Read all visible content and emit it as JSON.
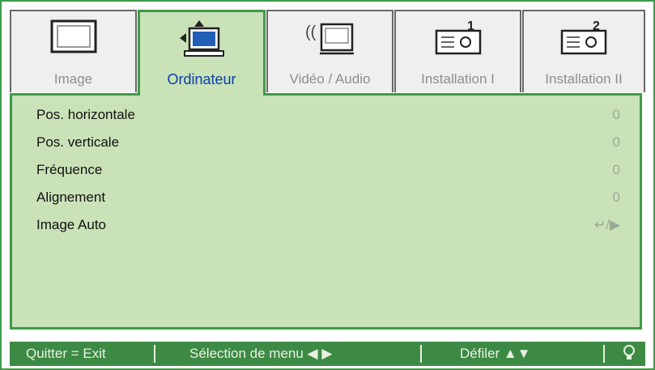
{
  "tabs": [
    {
      "label": "Image",
      "icon": "monitor-icon"
    },
    {
      "label": "Ordinateur",
      "icon": "computer-icon"
    },
    {
      "label": "Vidéo / Audio",
      "icon": "video-audio-icon"
    },
    {
      "label": "Installation I",
      "icon": "projector-1-icon"
    },
    {
      "label": "Installation II",
      "icon": "projector-2-icon"
    }
  ],
  "active_tab": "Ordinateur",
  "menu": [
    {
      "label": "Pos. horizontale",
      "value": "0"
    },
    {
      "label": "Pos. verticale",
      "value": "0"
    },
    {
      "label": "Fréquence",
      "value": "0"
    },
    {
      "label": "Alignement",
      "value": "0"
    },
    {
      "label": "Image Auto",
      "value": "↵/▶"
    }
  ],
  "footer": {
    "exit": "Quitter = Exit",
    "select": "Sélection de menu ◀ ▶",
    "scroll": "Défiler ▲▼",
    "bulb_icon": "lamp-icon"
  },
  "colors": {
    "accent": "#3d9a48",
    "panel": "#c9e2b7",
    "active_label": "#0a3da8"
  }
}
